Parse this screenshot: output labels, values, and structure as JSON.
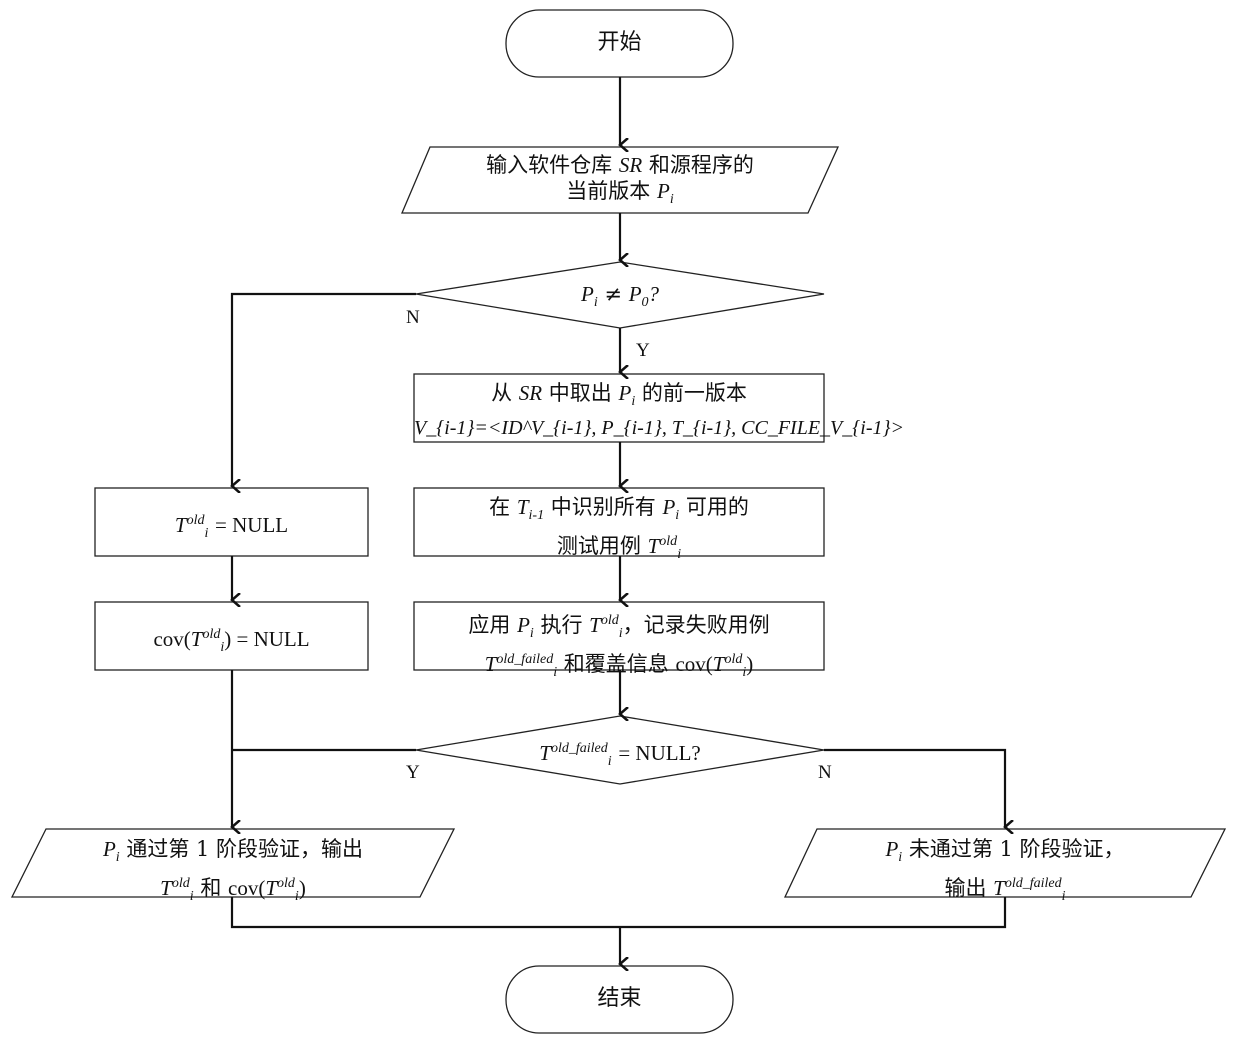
{
  "diagram": {
    "type": "flowchart",
    "nodes": {
      "start": {
        "shape": "terminator",
        "text": "开始"
      },
      "input": {
        "shape": "parallelogram",
        "line1": [
          "输入软件仓库",
          "SR",
          "和源程序的"
        ],
        "line2": [
          "当前版本",
          "P",
          "i"
        ]
      },
      "decision1": {
        "shape": "diamond",
        "text": [
          "P",
          "i",
          "≠",
          "P",
          "0",
          "?"
        ]
      },
      "fetch": {
        "shape": "process",
        "line1": [
          "从",
          "SR",
          "中取出",
          "P",
          "i",
          "的前一版本"
        ],
        "line2": "V_{i-1}=<ID^V_{i-1}, P_{i-1}, T_{i-1}, CC_FILE_V_{i-1}>"
      },
      "identify": {
        "shape": "process",
        "line1": [
          "在",
          "T",
          "i-1",
          "中识别所有",
          "P",
          "i",
          "可用的"
        ],
        "line2": [
          "测试用例",
          "T",
          "old",
          "i"
        ]
      },
      "execute": {
        "shape": "process",
        "line1": [
          "应用",
          "P",
          "i",
          "执行",
          "T",
          "old",
          "i",
          "，记录失败用例"
        ],
        "line2": [
          "T",
          "old_failed",
          "i",
          "和覆盖信息",
          "cov(",
          "T",
          "old",
          "i",
          ")"
        ]
      },
      "set_null": {
        "shape": "process",
        "text": [
          "T",
          "old",
          "i",
          "= NULL"
        ]
      },
      "cov_null": {
        "shape": "process",
        "text": [
          "cov(",
          "T",
          "old",
          "i",
          ") = NULL"
        ]
      },
      "decision2": {
        "shape": "diamond",
        "text": [
          "T",
          "old_failed",
          "i",
          "= NULL?"
        ]
      },
      "pass_out": {
        "shape": "parallelogram",
        "line1": [
          "P",
          "i",
          "通过第 1 阶段验证，输出"
        ],
        "line2": [
          "T",
          "old",
          "i",
          "和",
          "cov(",
          "T",
          "old",
          "i",
          ")"
        ]
      },
      "fail_out": {
        "shape": "parallelogram",
        "line1": [
          "P",
          "i",
          "未通过第 1 阶段验证，"
        ],
        "line2": [
          "输出",
          "T",
          "old_failed",
          "i"
        ]
      },
      "end": {
        "shape": "terminator",
        "text": "结束"
      }
    },
    "edge_labels": {
      "d1_no": "N",
      "d1_yes": "Y",
      "d2_yes": "Y",
      "d2_no": "N"
    },
    "edges": [
      [
        "start",
        "input"
      ],
      [
        "input",
        "decision1"
      ],
      [
        "decision1",
        "fetch",
        "Y"
      ],
      [
        "decision1",
        "set_null",
        "N"
      ],
      [
        "fetch",
        "identify"
      ],
      [
        "identify",
        "execute"
      ],
      [
        "execute",
        "decision2"
      ],
      [
        "set_null",
        "cov_null"
      ],
      [
        "cov_null",
        "pass_out"
      ],
      [
        "decision2",
        "pass_out",
        "Y"
      ],
      [
        "decision2",
        "fail_out",
        "N"
      ],
      [
        "pass_out",
        "end"
      ],
      [
        "fail_out",
        "end"
      ]
    ]
  }
}
